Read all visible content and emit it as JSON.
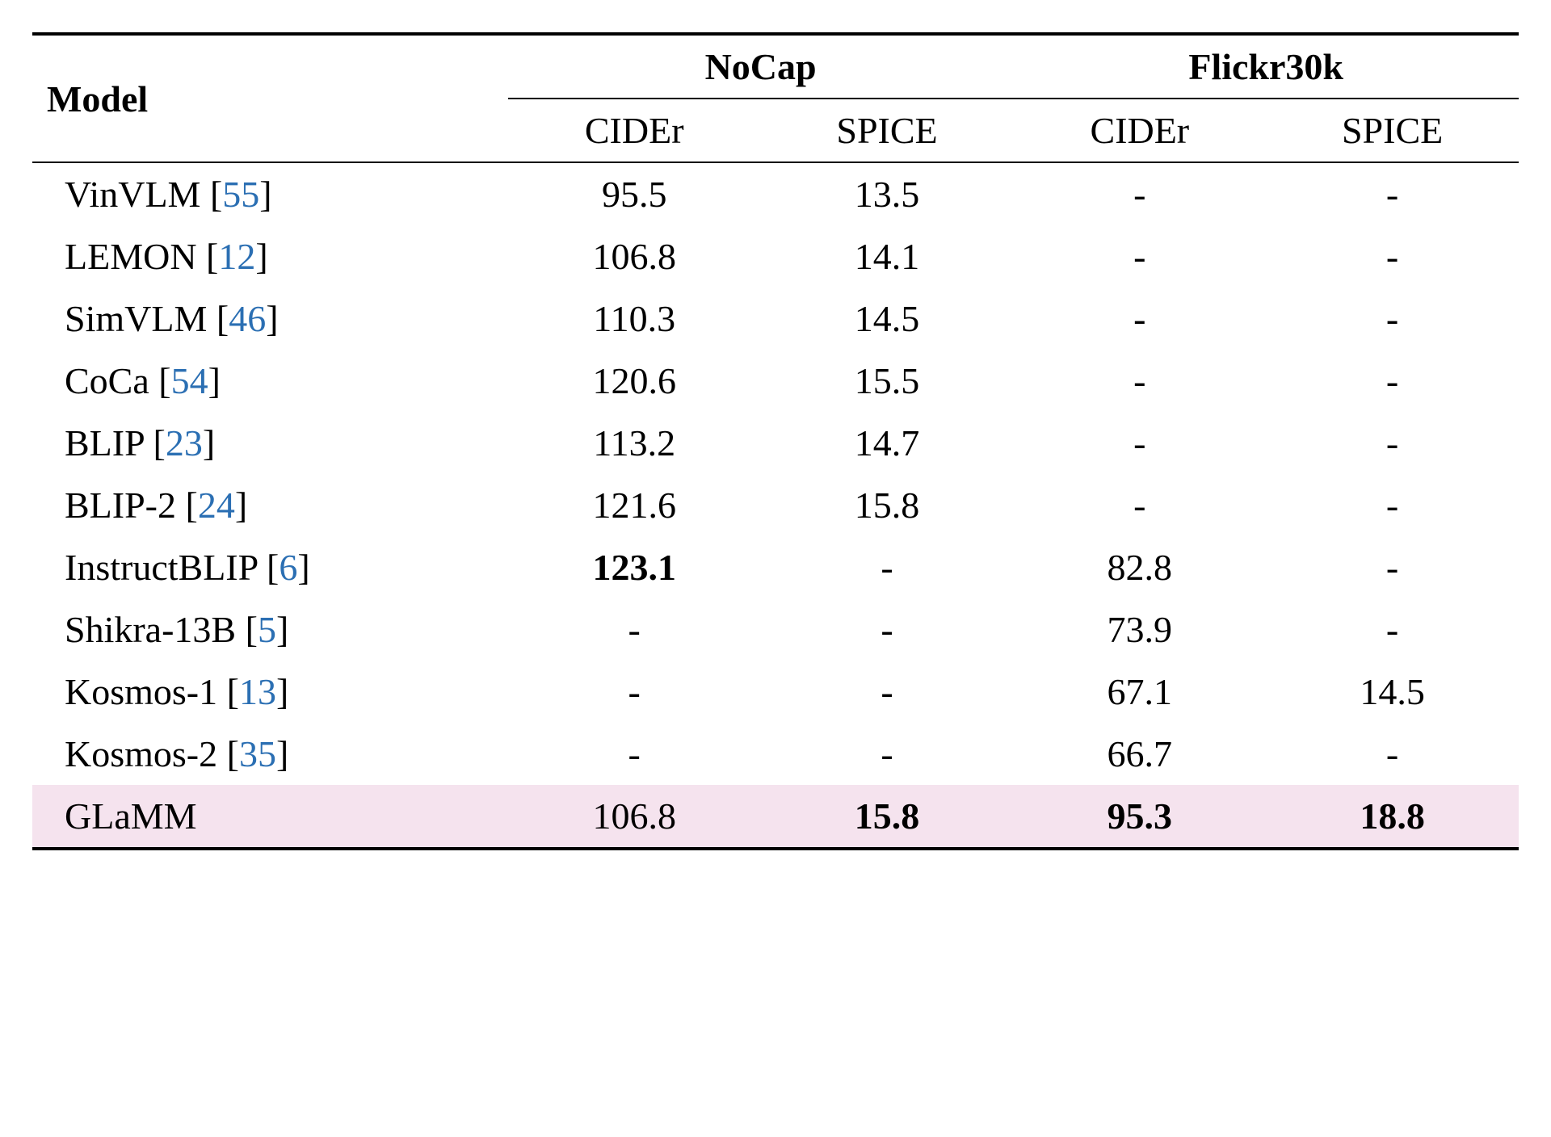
{
  "chart_data": {
    "type": "table",
    "title": "",
    "column_headers": {
      "model": "Model",
      "groups": [
        "NoCap",
        "Flickr30k"
      ],
      "metrics": [
        "CIDEr",
        "SPICE",
        "CIDEr",
        "SPICE"
      ]
    },
    "rows": [
      {
        "model": "VinVLM",
        "ref": "55",
        "nocap_cider": "95.5",
        "nocap_spice": "13.5",
        "flickr_cider": "-",
        "flickr_spice": "-",
        "bold": [],
        "hl": false
      },
      {
        "model": "LEMON",
        "ref": "12",
        "nocap_cider": "106.8",
        "nocap_spice": "14.1",
        "flickr_cider": "-",
        "flickr_spice": "-",
        "bold": [],
        "hl": false
      },
      {
        "model": "SimVLM",
        "ref": "46",
        "nocap_cider": "110.3",
        "nocap_spice": "14.5",
        "flickr_cider": "-",
        "flickr_spice": "-",
        "bold": [],
        "hl": false
      },
      {
        "model": "CoCa",
        "ref": "54",
        "nocap_cider": "120.6",
        "nocap_spice": "15.5",
        "flickr_cider": "-",
        "flickr_spice": "-",
        "bold": [],
        "hl": false
      },
      {
        "model": "BLIP",
        "ref": "23",
        "nocap_cider": "113.2",
        "nocap_spice": "14.7",
        "flickr_cider": "-",
        "flickr_spice": "-",
        "bold": [],
        "hl": false
      },
      {
        "model": "BLIP-2",
        "ref": "24",
        "nocap_cider": "121.6",
        "nocap_spice": "15.8",
        "flickr_cider": "-",
        "flickr_spice": "-",
        "bold": [],
        "hl": false
      },
      {
        "model": "InstructBLIP",
        "ref": "6",
        "nocap_cider": "123.1",
        "nocap_spice": "-",
        "flickr_cider": "82.8",
        "flickr_spice": "-",
        "bold": [
          "nocap_cider"
        ],
        "hl": false
      },
      {
        "model": "Shikra-13B",
        "ref": "5",
        "nocap_cider": "-",
        "nocap_spice": "-",
        "flickr_cider": "73.9",
        "flickr_spice": "-",
        "bold": [],
        "hl": false
      },
      {
        "model": "Kosmos-1",
        "ref": "13",
        "nocap_cider": "-",
        "nocap_spice": "-",
        "flickr_cider": "67.1",
        "flickr_spice": "14.5",
        "bold": [],
        "hl": false
      },
      {
        "model": "Kosmos-2",
        "ref": "35",
        "nocap_cider": "-",
        "nocap_spice": "-",
        "flickr_cider": "66.7",
        "flickr_spice": "-",
        "bold": [],
        "hl": false
      },
      {
        "model": "GLaMM",
        "ref": "",
        "nocap_cider": "106.8",
        "nocap_spice": "15.8",
        "flickr_cider": "95.3",
        "flickr_spice": "18.8",
        "bold": [
          "nocap_spice",
          "flickr_cider",
          "flickr_spice"
        ],
        "hl": true
      }
    ]
  }
}
